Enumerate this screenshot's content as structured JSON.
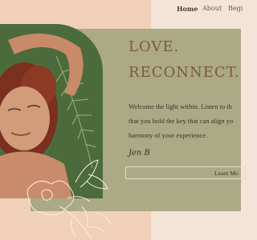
{
  "nav": {
    "items": [
      {
        "label": "Home",
        "active": true
      },
      {
        "label": "About",
        "active": false
      },
      {
        "label": "Begi",
        "active": false
      }
    ]
  },
  "hero": {
    "heading_line1": "LOVE.",
    "heading_line2": "RECONNECT. BE",
    "body_lines": [
      "Welcome the light within. Listen to th",
      "that you hold the key that can align yo",
      "harmony of your experience."
    ],
    "signature": "Jen B",
    "button_label": "Learn Mo"
  },
  "colors": {
    "peach_panel": "#f0d0b8",
    "pink_background": "#f4e4d7",
    "olive_panel": "#aca986",
    "heading_text": "#7a5b3a"
  },
  "icons": {
    "botanical_illustration": "flower-line-art",
    "photo": "woman-resting-on-grass-with-fern"
  }
}
